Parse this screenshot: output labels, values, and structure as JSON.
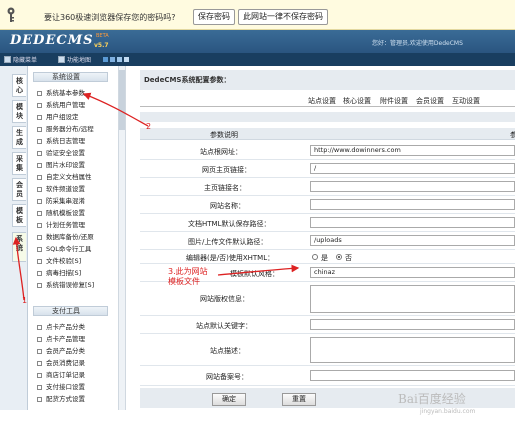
{
  "password_bar": {
    "prompt": "要让360极速浏览器保存您的密码吗?",
    "save_button": "保存密码",
    "never_button": "此网站一律不保存密码"
  },
  "header": {
    "logo": "DEDECMS",
    "version": "v5.7",
    "beta": "BETA",
    "welcome": "您好：管理员,欢迎使用DedeCMS"
  },
  "menubar": {
    "hide_menu": "隐藏菜单",
    "feature_map": "功能地图"
  },
  "left_tabs": [
    "核心",
    "模块",
    "生成",
    "采集",
    "会员",
    "模板",
    "系统"
  ],
  "nav": {
    "section1": "系统设置",
    "items1": [
      "系统基本参数",
      "系统用户管理",
      "用户组设定",
      "服务器分布/远程",
      "系统日志管理",
      "验证安全设置",
      "图片水印设置",
      "自定义文档属性",
      "软件频道设置",
      "防采集串混淆",
      "随机模板设置",
      "计划任务管理",
      "数据库备份/还原",
      "SQL命令行工具",
      "文件校验[S]",
      "病毒扫描[S]",
      "系统错误修复[S]"
    ],
    "section2": "支付工具",
    "items2": [
      "点卡产品分类",
      "点卡产品管理",
      "会员产品分类",
      "会员消费记录",
      "商店订单记录",
      "支付接口设置",
      "配货方式设置"
    ]
  },
  "main": {
    "title": "DedeCMS系统配置参数：",
    "tabs": [
      "站点设置",
      "核心设置",
      "附件设置",
      "会员设置",
      "互动设置"
    ],
    "col_header": "参数说明",
    "col_header2": "参",
    "rows": [
      {
        "label": "站点根网址：",
        "value": "http://www.dowinners.com"
      },
      {
        "label": "网页主页链接：",
        "value": "/"
      },
      {
        "label": "主页链接名：",
        "value": ""
      },
      {
        "label": "网站名称：",
        "value": ""
      },
      {
        "label": "文档HTML默认保存路径：",
        "value": ""
      },
      {
        "label": "图片/上传文件默认路径：",
        "value": "/uploads"
      },
      {
        "label": "编辑器(是/否)使用XHTML：",
        "value": ""
      },
      {
        "label": "模板默认风格：",
        "value": "chinaz"
      },
      {
        "label": "网站版权信息：",
        "value": ""
      },
      {
        "label": "站点默认关键字：",
        "value": ""
      },
      {
        "label": "站点描述：",
        "value": ""
      },
      {
        "label": "网站备案号：",
        "value": ""
      }
    ],
    "radio_yes": "是",
    "radio_no": "否",
    "confirm": "确定",
    "reset": "重置"
  },
  "annotations": {
    "a1": "1",
    "a2": "2",
    "a3_line1": "3.此为网站",
    "a3_line2": "模板文件"
  },
  "watermark": "Bai百度经验",
  "watermark_sub": "jingyan.baidu.com",
  "colors": {
    "annotation": "#dd2222",
    "header": "#2a5580",
    "menubar": "#193e60"
  }
}
